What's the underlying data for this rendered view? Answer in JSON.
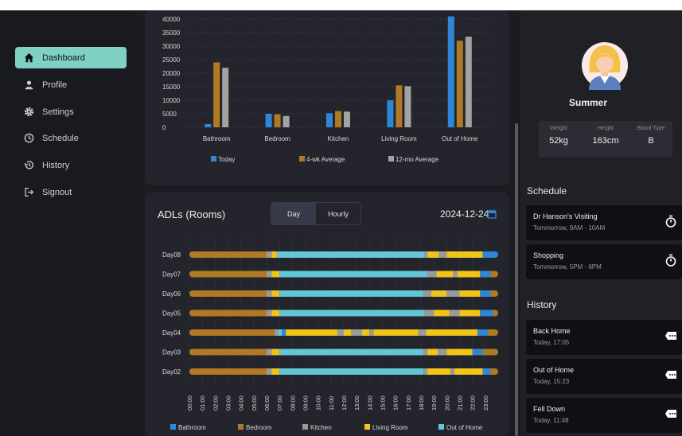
{
  "sidebar": {
    "items": [
      {
        "label": "Dashboard",
        "icon": "home-icon",
        "active": true
      },
      {
        "label": "Profile",
        "icon": "person-icon"
      },
      {
        "label": "Settings",
        "icon": "gear-icon"
      },
      {
        "label": "Schedule",
        "icon": "clock-icon"
      },
      {
        "label": "History",
        "icon": "history-icon"
      },
      {
        "label": "Signout",
        "icon": "signout-icon"
      }
    ]
  },
  "profile": {
    "name": "Summer",
    "weight_label": "Weight",
    "weight": "52kg",
    "height_label": "Height",
    "height": "163cm",
    "blood_label": "Blood Type",
    "blood": "B"
  },
  "schedule": {
    "title": "Schedule",
    "items": [
      {
        "title": "Dr Hanson's Visiting",
        "time": "Tommorrow, 9AM - 10AM",
        "icon": "stopwatch-icon"
      },
      {
        "title": "Shopping",
        "time": "Tommorrow, 5PM - 6PM",
        "icon": "stopwatch-icon"
      }
    ]
  },
  "history": {
    "title": "History",
    "items": [
      {
        "title": "Back Home",
        "time": "Today, 17:05",
        "icon": "message-icon"
      },
      {
        "title": "Out of Home",
        "time": "Today, 15:23",
        "icon": "message-icon"
      },
      {
        "title": "Fell Down",
        "time": "Today, 11:48",
        "icon": "message-icon"
      }
    ]
  },
  "adl": {
    "title": "ADLs (Rooms)",
    "toggle": [
      "Day",
      "Hourly"
    ],
    "date": "2024-12-24"
  },
  "colors": {
    "today": "#2f86d6",
    "wk4": "#b07a24",
    "mo12": "#a3a3a3",
    "bathroom": "#2f86d6",
    "bedroom": "#b07a24",
    "kitchen": "#9a9a9a",
    "living": "#f0c419",
    "outhome": "#62c6d6"
  },
  "chart_data": [
    {
      "type": "bar",
      "categories": [
        "Bathroom",
        "Bedroom",
        "Kitchen",
        "Living Room",
        "Out of Home"
      ],
      "series": [
        {
          "name": "Today",
          "values": [
            1200,
            5000,
            5200,
            10000,
            41000
          ]
        },
        {
          "name": "4-wk Average",
          "values": [
            24000,
            4800,
            6000,
            15500,
            32000
          ]
        },
        {
          "name": "12-mo Average",
          "values": [
            22000,
            4200,
            5800,
            15200,
            33500
          ]
        }
      ],
      "yticks": [
        0,
        5000,
        10000,
        15000,
        20000,
        25000,
        30000,
        35000,
        40000
      ],
      "ylim": [
        0,
        40000
      ],
      "legend": "bottom"
    },
    {
      "type": "bar",
      "orientation": "horizontal-stacked",
      "categories": [
        "Day08",
        "Day07",
        "Day06",
        "Day05",
        "Day04",
        "Day03",
        "Day02"
      ],
      "xticks": [
        "00:00",
        "01:00",
        "02:00",
        "03:00",
        "04:00",
        "05:00",
        "06:00",
        "07:00",
        "08:00",
        "09:00",
        "10:00",
        "11:00",
        "12:00",
        "13:00",
        "14:00",
        "15:00",
        "16:00",
        "17:00",
        "18:00",
        "19:00",
        "20:00",
        "21:00",
        "22:00",
        "23:00"
      ],
      "xlim": [
        0,
        24
      ],
      "legend_labels": [
        "Bathroom",
        "Bedroom",
        "Kitchen",
        "Living Room",
        "Out of Home"
      ],
      "legend": "bottom",
      "rows": [
        [
          [
            "bedroom",
            0,
            6
          ],
          [
            "kitchen",
            6,
            6.4
          ],
          [
            "living",
            6.4,
            6.8
          ],
          [
            "outhome",
            6.8,
            18.3
          ],
          [
            "kitchen",
            18.3,
            18.5
          ],
          [
            "living",
            18.5,
            19.4
          ],
          [
            "kitchen",
            19.4,
            20
          ],
          [
            "living",
            20,
            22.8
          ],
          [
            "bathroom",
            22.8,
            24
          ]
        ],
        [
          [
            "bedroom",
            0,
            6
          ],
          [
            "kitchen",
            6,
            6.4
          ],
          [
            "living",
            6.4,
            7
          ],
          [
            "outhome",
            7,
            18.5
          ],
          [
            "kitchen",
            18.5,
            19.2
          ],
          [
            "living",
            19.2,
            20.5
          ],
          [
            "kitchen",
            20.5,
            20.8
          ],
          [
            "living",
            20.8,
            22.6
          ],
          [
            "bathroom",
            22.6,
            23.4
          ],
          [
            "bedroom",
            23.4,
            24
          ]
        ],
        [
          [
            "bedroom",
            0,
            6
          ],
          [
            "kitchen",
            6,
            6.4
          ],
          [
            "living",
            6.4,
            7
          ],
          [
            "outhome",
            7,
            18.2
          ],
          [
            "kitchen",
            18.2,
            18.8
          ],
          [
            "living",
            18.8,
            20
          ],
          [
            "kitchen",
            20,
            21
          ],
          [
            "living",
            21,
            22.6
          ],
          [
            "bathroom",
            22.6,
            23.4
          ],
          [
            "bedroom",
            23.4,
            24
          ]
        ],
        [
          [
            "bedroom",
            0,
            6
          ],
          [
            "kitchen",
            6,
            6.4
          ],
          [
            "living",
            6.4,
            7
          ],
          [
            "outhome",
            7,
            18.3
          ],
          [
            "kitchen",
            18.3,
            19
          ],
          [
            "living",
            19,
            20.2
          ],
          [
            "kitchen",
            20.2,
            21
          ],
          [
            "living",
            21,
            22.6
          ],
          [
            "bathroom",
            22.6,
            23.6
          ],
          [
            "bedroom",
            23.6,
            24
          ]
        ],
        [
          [
            "bedroom",
            0,
            6.6
          ],
          [
            "kitchen",
            6.6,
            6.9
          ],
          [
            "outhome",
            6.9,
            7.2
          ],
          [
            "bathroom",
            7.2,
            7.5
          ],
          [
            "living",
            7.5,
            11.5
          ],
          [
            "kitchen",
            11.5,
            12
          ],
          [
            "living",
            12,
            12.6
          ],
          [
            "kitchen",
            12.6,
            13.4
          ],
          [
            "living",
            13.4,
            14
          ],
          [
            "kitchen",
            14,
            14.3
          ],
          [
            "living",
            14.3,
            17.8
          ],
          [
            "kitchen",
            17.8,
            18.4
          ],
          [
            "living",
            18.4,
            22.4
          ],
          [
            "bathroom",
            22.4,
            23.2
          ],
          [
            "bedroom",
            23.2,
            24
          ]
        ],
        [
          [
            "bedroom",
            0,
            6
          ],
          [
            "kitchen",
            6,
            6.4
          ],
          [
            "living",
            6.4,
            7
          ],
          [
            "outhome",
            7,
            18.2
          ],
          [
            "kitchen",
            18.2,
            18.5
          ],
          [
            "living",
            18.5,
            19.3
          ],
          [
            "kitchen",
            19.3,
            20
          ],
          [
            "living",
            20,
            22
          ],
          [
            "bathroom",
            22,
            22.8
          ],
          [
            "bedroom",
            22.8,
            24
          ]
        ],
        [
          [
            "bedroom",
            0,
            6
          ],
          [
            "kitchen",
            6,
            6.4
          ],
          [
            "living",
            6.4,
            7
          ],
          [
            "outhome",
            7,
            18.2
          ],
          [
            "kitchen",
            18.2,
            18.5
          ],
          [
            "living",
            18.5,
            20.3
          ],
          [
            "kitchen",
            20.3,
            20.6
          ],
          [
            "living",
            20.6,
            22.8
          ],
          [
            "bathroom",
            22.8,
            23.4
          ],
          [
            "bedroom",
            23.4,
            24
          ]
        ]
      ]
    }
  ]
}
